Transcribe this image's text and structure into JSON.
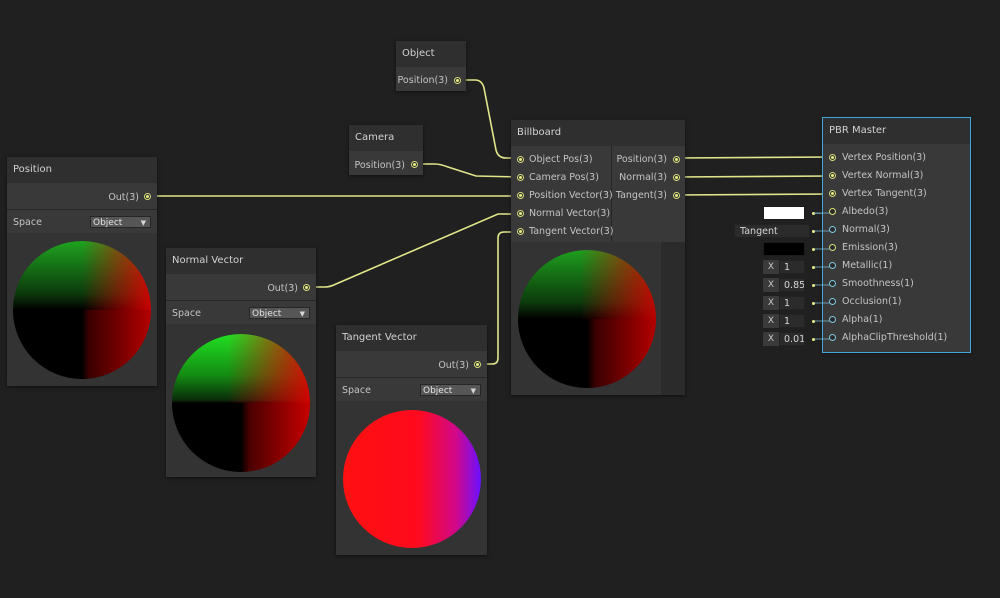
{
  "nodes": {
    "object": {
      "title": "Object",
      "port_out": "Position(3)"
    },
    "camera": {
      "title": "Camera",
      "port_out": "Position(3)"
    },
    "position": {
      "title": "Position",
      "port_out": "Out(3)",
      "space_label": "Space",
      "space_value": "Object"
    },
    "normal_vector": {
      "title": "Normal Vector",
      "port_out": "Out(3)",
      "space_label": "Space",
      "space_value": "Object"
    },
    "tangent_vector": {
      "title": "Tangent Vector",
      "port_out": "Out(3)",
      "space_label": "Space",
      "space_value": "Object"
    },
    "billboard": {
      "title": "Billboard",
      "inputs": [
        "Object Pos(3)",
        "Camera Pos(3)",
        "Position Vector(3)",
        "Normal Vector(3)",
        "Tangent Vector(3)"
      ],
      "outputs": [
        "Position(3)",
        "Normal(3)",
        "Tangent(3)"
      ]
    },
    "pbr_master": {
      "title": "PBR Master",
      "inputs": [
        "Vertex Position(3)",
        "Vertex Normal(3)",
        "Vertex Tangent(3)",
        "Albedo(3)",
        "Normal(3)",
        "Emission(3)",
        "Metallic(1)",
        "Smoothness(1)",
        "Occlusion(1)",
        "Alpha(1)",
        "AlphaClipThreshold(1)"
      ],
      "defaults": {
        "albedo_color": "#ffffff",
        "normal_space": "Tangent Space",
        "emission_color": "#000000",
        "x_label": "X",
        "metallic": "1",
        "smoothness": "0.85",
        "occlusion": "1",
        "alpha": "1",
        "alpha_clip": "0.01"
      }
    }
  },
  "colors": {
    "background": "#202020",
    "node_body": "#393939",
    "node_header": "#2f2f2f",
    "wire": "#e2e68a",
    "selection": "#44a6d8"
  }
}
